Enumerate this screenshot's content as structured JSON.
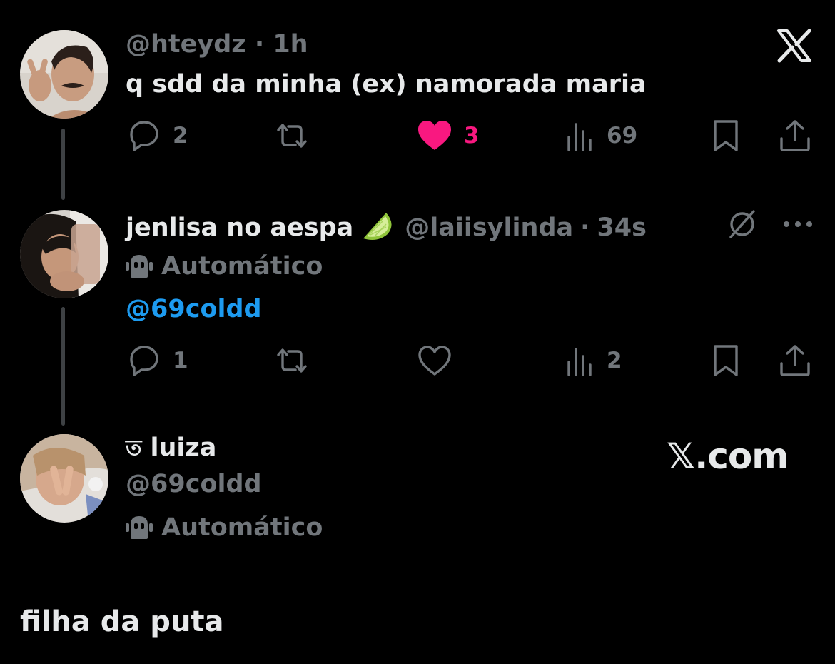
{
  "tweet1": {
    "handle": "@hteydz",
    "separator": "·",
    "time": "1h",
    "text": "q sdd da minha (ex) namorada maria",
    "reply_count": "2",
    "like_count": "3",
    "views_count": "69",
    "liked": true
  },
  "tweet2": {
    "display_name": "jenlisa no aespa",
    "emoji": "lime",
    "handle": "@laiisylinda",
    "separator": "·",
    "time": "34s",
    "automated_label": "Automático",
    "text": "@69coldd",
    "reply_count": "1",
    "views_count": "2"
  },
  "profile": {
    "symbol": "ত",
    "display_name": "luiza",
    "handle": "@69coldd",
    "automated_label": "Automático"
  },
  "watermark": "𝕏.com",
  "caption": "filha da puta",
  "colors": {
    "background": "#000000",
    "text": "#e7e9ea",
    "muted": "#71767b",
    "like": "#f91880",
    "link": "#1d9bf0",
    "thread_line": "#3e4144"
  },
  "icons": {
    "logo": "x-logo-icon",
    "reply": "reply-icon",
    "repost": "repost-icon",
    "like": "heart-icon",
    "views": "views-icon",
    "bookmark": "bookmark-icon",
    "share": "share-icon",
    "muted": "no-entry-icon",
    "more": "more-icon",
    "automated": "robot-icon"
  }
}
